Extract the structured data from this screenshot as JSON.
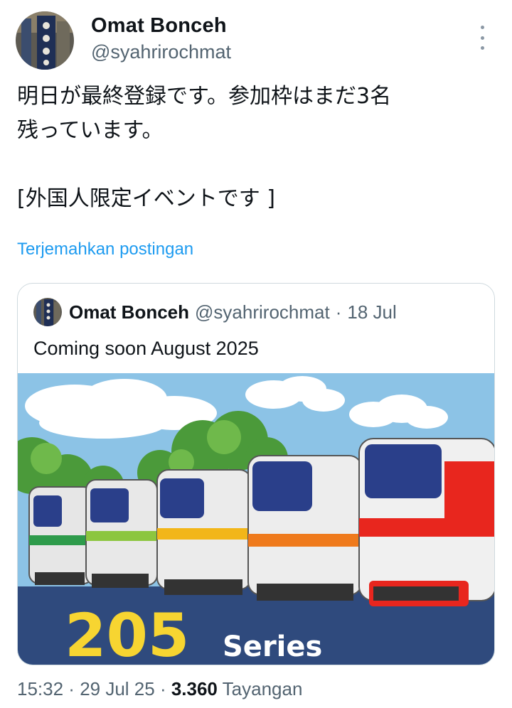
{
  "author": {
    "display_name": "Omat Bonceh",
    "handle": "@syahrirochmat"
  },
  "tweet": {
    "text": "明日が最終登録です。参加枠はまだ3名\n残っています。\n\n[外国人限定イベントです ]",
    "translate_label": "Terjemahkan postingan"
  },
  "quote": {
    "display_name": "Omat Bonceh",
    "handle": "@syahrirochmat",
    "separator": "·",
    "date": "18 Jul",
    "text": "Coming soon August 2025",
    "media": {
      "number": "205",
      "word": "Series",
      "colors": {
        "sky": "#8cc3e6",
        "ground": "#2f4a7d",
        "number_yellow": "#f7d531",
        "red_stripe": "#e8261e",
        "orange_stripe": "#ef7a1c",
        "yellow_stripe": "#f2b619",
        "green_stripe": "#8cc63f",
        "dark_green_stripe": "#2e9b4b"
      }
    }
  },
  "meta": {
    "time": "15:32",
    "sep1": " · ",
    "date": "29 Jul 25",
    "sep2": " · ",
    "views": "3.360",
    "views_label": " Tayangan"
  },
  "icons": [
    "more-vertical-icon"
  ]
}
